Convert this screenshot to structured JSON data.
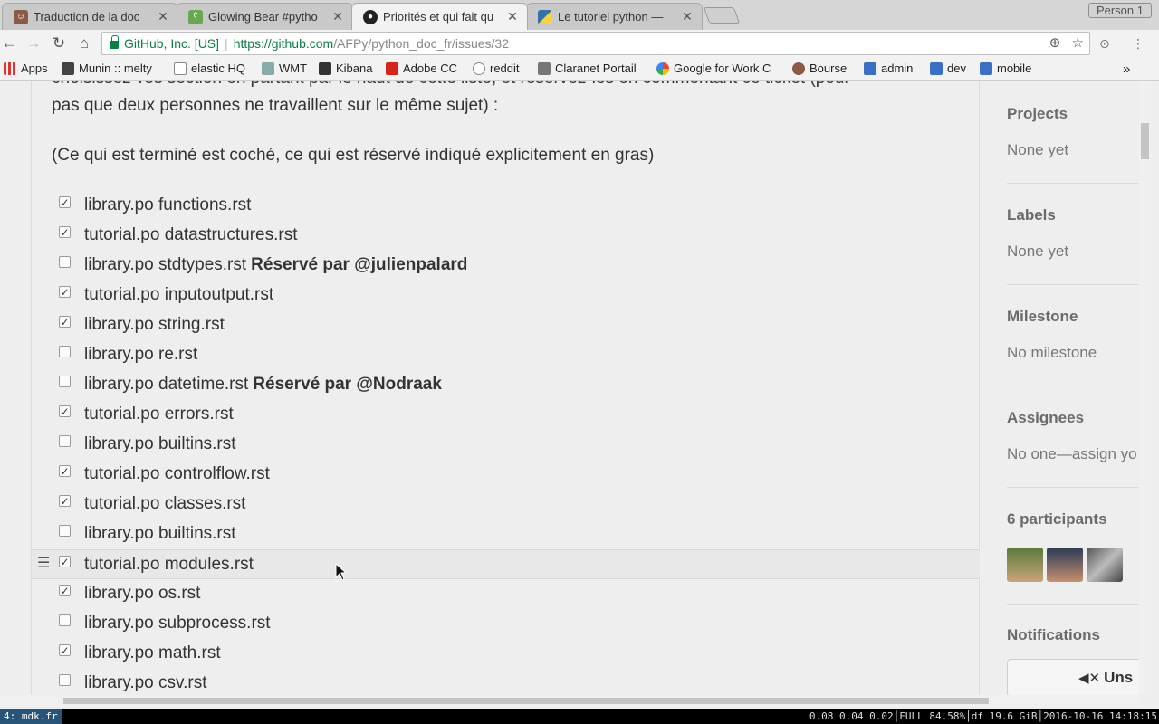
{
  "tabs": [
    {
      "title": "Traduction de la doc",
      "icon": "person-avatar-icon"
    },
    {
      "title": "Glowing Bear #pytho",
      "icon": "bear-icon"
    },
    {
      "title": "Priorités et qui fait qu",
      "icon": "github-icon"
    },
    {
      "title": "Le tutoriel python —",
      "icon": "python-icon"
    }
  ],
  "profile_label": "Person 1",
  "address": {
    "security_label": "GitHub, Inc. [US]",
    "host": "https://github.com",
    "path": "/AFPy/python_doc_fr/issues/32"
  },
  "bookmarks": [
    "Apps",
    "Munin :: melty",
    "elastic HQ",
    "WMT",
    "Kibana",
    "Adobe CC",
    "reddit",
    "Claranet Portail",
    "Google for Work C",
    "Bourse",
    "admin",
    "dev",
    "mobile"
  ],
  "bookmarks_more": "»",
  "issue": {
    "intro_line1": "choisissez vos section en partant par le haut de cette liste, et réservez-les en commentant ce ticket (pour",
    "intro_line2": "pas que deux personnes ne travaillent sur le même sujet) :",
    "legend": "(Ce qui est terminé est coché, ce qui est réservé indiqué explicitement en gras)",
    "tasks": [
      {
        "text": "library.po functions.rst",
        "checked": true,
        "reserved": ""
      },
      {
        "text": "tutorial.po datastructures.rst",
        "checked": true,
        "reserved": ""
      },
      {
        "text": "library.po stdtypes.rst",
        "checked": false,
        "reserved": "Réservé par @julienpalard"
      },
      {
        "text": "tutorial.po inputoutput.rst",
        "checked": true,
        "reserved": ""
      },
      {
        "text": "library.po string.rst",
        "checked": true,
        "reserved": ""
      },
      {
        "text": "library.po re.rst",
        "checked": false,
        "reserved": ""
      },
      {
        "text": "library.po datetime.rst",
        "checked": false,
        "reserved": "Réservé par @Nodraak"
      },
      {
        "text": "tutorial.po errors.rst",
        "checked": true,
        "reserved": ""
      },
      {
        "text": "library.po builtins.rst",
        "checked": false,
        "reserved": ""
      },
      {
        "text": "tutorial.po controlflow.rst",
        "checked": true,
        "reserved": ""
      },
      {
        "text": "tutorial.po classes.rst",
        "checked": true,
        "reserved": ""
      },
      {
        "text": "library.po builtins.rst",
        "checked": false,
        "reserved": ""
      },
      {
        "text": "tutorial.po modules.rst",
        "checked": true,
        "reserved": ""
      },
      {
        "text": "library.po os.rst",
        "checked": true,
        "reserved": ""
      },
      {
        "text": "library.po subprocess.rst",
        "checked": false,
        "reserved": ""
      },
      {
        "text": "library.po math.rst",
        "checked": true,
        "reserved": ""
      },
      {
        "text": "library.po csv.rst",
        "checked": false,
        "reserved": ""
      }
    ],
    "hovered_task_index": 12
  },
  "sidebar": {
    "projects_title": "Projects",
    "projects_value": "None yet",
    "labels_title": "Labels",
    "labels_value": "None yet",
    "milestone_title": "Milestone",
    "milestone_value": "No milestone",
    "assignees_title": "Assignees",
    "assignees_value": "No one—assign yo",
    "participants_title": "6 participants",
    "notifications_title": "Notifications",
    "unsubscribe_label": "Uns"
  },
  "statusbar": {
    "workspace": "4: mdk.fr",
    "info": "0.08 0.04 0.02│FULL 84.58%│df 19.6 GiB│2016-10-16 14:18:15"
  },
  "colors": {
    "secure_green": "#0b8043",
    "workspace_blue": "#285577"
  }
}
